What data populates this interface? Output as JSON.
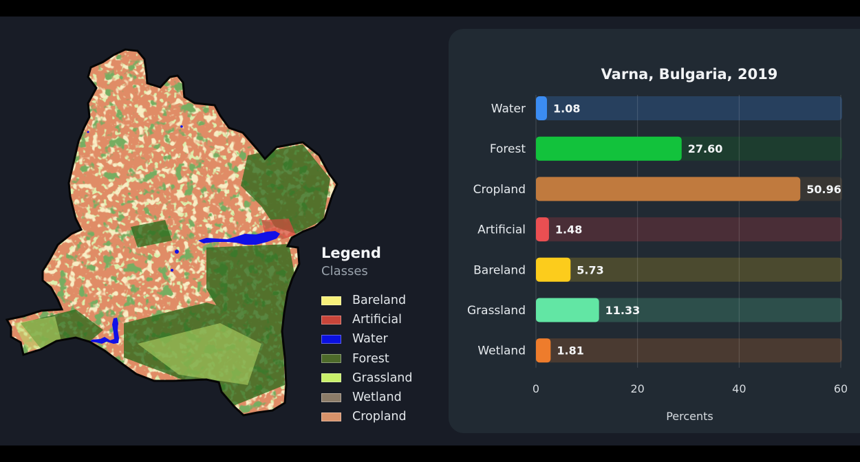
{
  "legend": {
    "title": "Legend",
    "subtitle": "Classes",
    "items": [
      {
        "label": "Bareland",
        "color": "#f7f07a"
      },
      {
        "label": "Artificial",
        "color": "#c8453a"
      },
      {
        "label": "Water",
        "color": "#0a10e0"
      },
      {
        "label": "Forest",
        "color": "#4d6a2a"
      },
      {
        "label": "Grassland",
        "color": "#c8ef6a"
      },
      {
        "label": "Wetland",
        "color": "#8b7b68"
      },
      {
        "label": "Cropland",
        "color": "#d8926a"
      }
    ]
  },
  "map": {
    "region": "Varna province land cover map",
    "colors": {
      "cropland": "#e08c66",
      "forest": "#2e6a1e",
      "grassland": "#b9dc6a",
      "bareland": "#efe08a",
      "water": "#1010e6",
      "artificial": "#d84a40",
      "border": "#050505"
    }
  },
  "chart_data": {
    "type": "bar",
    "orientation": "horizontal",
    "title": "Varna, Bulgaria, 2019",
    "xlabel": "Percents",
    "ylabel": "",
    "xlim": [
      0,
      60
    ],
    "xticks": [
      "0",
      "20",
      "40",
      "60"
    ],
    "xtick_values": [
      0,
      20,
      40,
      60
    ],
    "grid": "vertical",
    "categories": [
      "Water",
      "Forest",
      "Cropland",
      "Artificial",
      "Bareland",
      "Grassland",
      "Wetland"
    ],
    "values": [
      1.08,
      27.6,
      50.96,
      1.48,
      5.73,
      11.33,
      1.81
    ],
    "value_labels": [
      "1.08",
      "27.60",
      "50.96",
      "1.48",
      "5.73",
      "11.33",
      "1.81"
    ],
    "bar_colors": [
      "#3b8cf2",
      "#12c23c",
      "#c07a3e",
      "#ea4f52",
      "#fccc1c",
      "#62e6a4",
      "#ee7c2c"
    ],
    "track_colors": [
      "#27405e",
      "#1d3d2f",
      "#383633",
      "#4a2e37",
      "#4b4a2f",
      "#2d4f4b",
      "#4a3a31"
    ]
  }
}
